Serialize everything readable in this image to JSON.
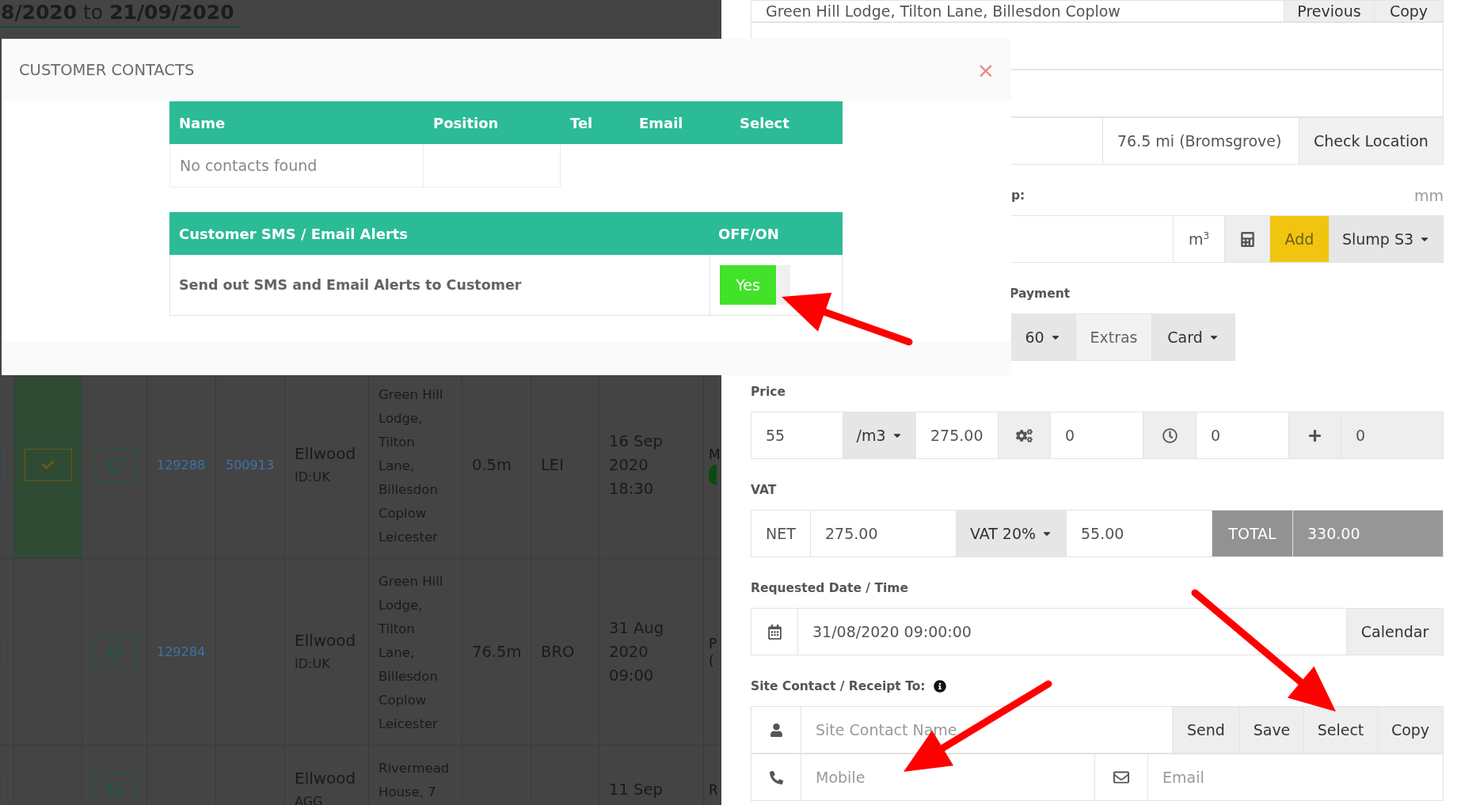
{
  "background_page": {
    "date_range": {
      "start": "8/2020",
      "joiner": "to",
      "end": "21/09/2020"
    },
    "orders": [
      {
        "selected": true,
        "confirmed": true,
        "job_no": "129288",
        "order_no": "500913",
        "customer": "Ellwood",
        "customer_code": "ID:UK",
        "address_lines": [
          "Green Hill",
          "Lodge,",
          "Tilton",
          "Lane,",
          "Billesdon",
          "Coplow",
          "Leicester"
        ],
        "distance": "0.5m",
        "depot": "LEI",
        "date_lines": [
          "16 Sep",
          "2020",
          "18:30"
        ],
        "column_11": [
          "M"
        ],
        "status_dot": true
      },
      {
        "selected": false,
        "confirmed": false,
        "job_no": "129284",
        "customer": "Ellwood",
        "customer_code": "ID:UK",
        "address_lines": [
          "Green Hill",
          "Lodge,",
          "Tilton",
          "Lane,",
          "Billesdon",
          "Coplow",
          "Leicester"
        ],
        "distance": "76.5m",
        "depot": "BRO",
        "date_lines": [
          "31 Aug",
          "2020",
          "09:00"
        ],
        "column_11": [
          "P",
          "("
        ],
        "status_dot": false
      },
      {
        "selected": false,
        "confirmed": false,
        "customer": "Ellwood",
        "customer_code": "AGG",
        "address_lines": [
          "Rivermead",
          "House, 7"
        ],
        "date_lines": [
          "11 Sep"
        ],
        "column_11": [
          "R"
        ],
        "status_dot": false
      }
    ]
  },
  "modal": {
    "title": "CUSTOMER CONTACTS",
    "close": "×",
    "contacts_table": {
      "columns": [
        "Name",
        "Position",
        "Tel",
        "Email",
        "Select"
      ],
      "empty_message": "No contacts found"
    },
    "alerts_table": {
      "columns": [
        "Customer SMS / Email Alerts",
        "OFF/ON"
      ],
      "rows": [
        {
          "text": "Send out SMS and Email Alerts to Customer",
          "on": true,
          "label": "Yes"
        }
      ]
    }
  },
  "order_form": {
    "site_address": {
      "value": "Green Hill Lodge, Tilton Lane, Billesdon Coplow",
      "buttons": [
        "Previous",
        "Copy"
      ]
    },
    "distance": {
      "value": "76.5 mi (Bromsgrove)",
      "button": "Check Location"
    },
    "quantity": {
      "label": "p:",
      "unit_hint": "mm",
      "unit": "m$^{3}$",
      "add_button": "Add",
      "slump": "Slump S3"
    },
    "payment": {
      "label": "Payment",
      "terms": "60",
      "extras": "Extras",
      "method": "Card"
    },
    "price": {
      "label": "Price",
      "rate": "55",
      "per": "/m3",
      "amount": "275.00",
      "extras_value": "0",
      "time_value": "0",
      "other_value": "0"
    },
    "vat": {
      "label": "VAT",
      "net_label": "NET",
      "net": "275.00",
      "rate": "VAT 20%",
      "vat_amount": "55.00",
      "total_label": "TOTAL",
      "total": "330.00"
    },
    "requested": {
      "label": "Requested Date / Time",
      "value": "31/08/2020 09:00:00",
      "button": "Calendar"
    },
    "site_contact": {
      "label": "Site Contact / Receipt To:",
      "name_placeholder": "Site Contact Name",
      "buttons": [
        "Send",
        "Save",
        "Select",
        "Copy"
      ],
      "mobile_placeholder": "Mobile",
      "email_placeholder": "Email"
    }
  }
}
